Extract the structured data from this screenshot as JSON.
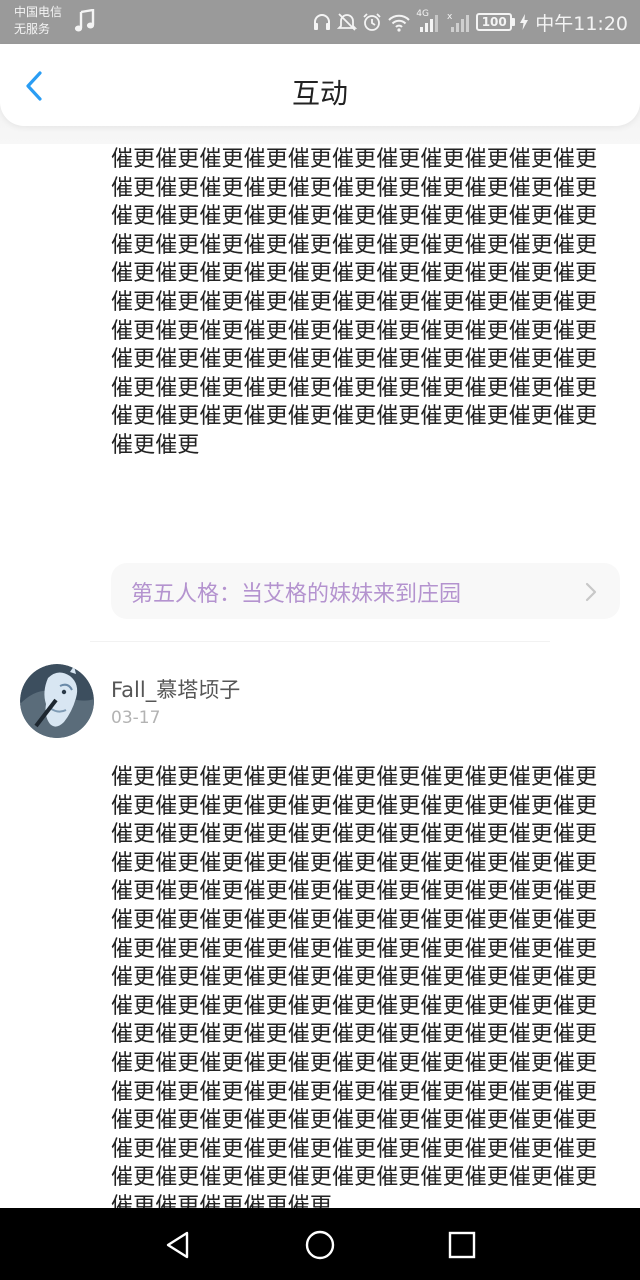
{
  "status_bar": {
    "carrier_line1": "中国电信",
    "carrier_line2": "无服务",
    "network": "4G",
    "battery": "100",
    "time": "中午11:20"
  },
  "header": {
    "title": "互动"
  },
  "comments": [
    {
      "body": "催更催更催更催更催更催更催更催更催更催更催更催更催更催更催更催更催更催更催更催更催更催更催更催更催更催更催更催更催更催更催更催更催更催更催更催更催更催更催更催更催更催更催更催更催更催更催更催更催更催更催更催更催更催更催更催更催更催更催更催更催更催更催更催更催更催更催更催更催更催更催更催更催更催更催更催更催更催更催更催更催更催更催更催更催更催更催更催更催更催更催更催更催更催更催更催更催更催更催更催更催更催更催更催更催更催更催更催更催更催更催更催更",
      "link_title": "第五人格：当艾格的妹妹来到庄园"
    },
    {
      "username": "Fall_慕塔顷子",
      "date": "03-17",
      "body": "催更催更催更催更催更催更催更催更催更催更催更催更催更催更催更催更催更催更催更催更催更催更催更催更催更催更催更催更催更催更催更催更催更催更催更催更催更催更催更催更催更催更催更催更催更催更催更催更催更催更催更催更催更催更催更催更催更催更催更催更催更催更催更催更催更催更催更催更催更催更催更催更催更催更催更催更催更催更催更催更催更催更催更催更催更催更催更催更催更催更催更催更催更催更催更催更催更催更催更催更催更催更催更催更催更催更催更催更催更催更催更催更催更催更催更催更催更催更催更催更催更催更催更催更催更催更催更催更催更催更催更催更催更催更催更催更催更催更催更催更催更催更催更催更催更催更催更催更催更催更催更催更催更催更催更催更催更催更催更催更催更催更催更催更催更催更催更催更催更催更"
    }
  ],
  "icons": {
    "back": "chevron-left-icon",
    "link_arrow": "chevron-right-icon",
    "nav_back": "triangle-back-icon",
    "nav_home": "circle-home-icon",
    "nav_recent": "square-recent-icon"
  },
  "colors": {
    "accent": "#2a9df4",
    "link_text": "#b493cf",
    "status_bar": "#9a9a9a"
  }
}
